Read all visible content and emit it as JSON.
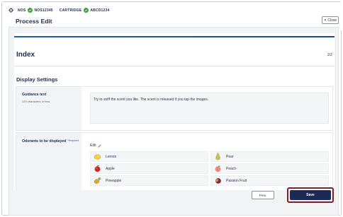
{
  "status": {
    "nos_label": "NOS",
    "nos_value": "NOS12345",
    "cartridge_label": "CARTRIDGE",
    "cartridge_value": "ABCD1234"
  },
  "header": {
    "title": "Process Edit",
    "close_label": "✕ Close"
  },
  "main": {
    "heading": "Index",
    "page_indicator": "2/2",
    "section_title": "Display Settings",
    "progress": 1.0
  },
  "guidance": {
    "label": "Guidance text",
    "sublabel": "120 characters or less",
    "value": "Try to sniff the scent you like. The scent is released if you tap the images."
  },
  "odorants": {
    "label": "Odorants to be displayed",
    "required": "*Required",
    "edit_label": "Edit",
    "items": [
      {
        "name": "Lemon",
        "icon": "lemon-icon"
      },
      {
        "name": "Pear",
        "icon": "pear-icon"
      },
      {
        "name": "Apple",
        "icon": "apple-icon"
      },
      {
        "name": "Peach",
        "icon": "peach-icon"
      },
      {
        "name": "Pineapple",
        "icon": "pineapple-icon"
      },
      {
        "name": "Passion Fruit",
        "icon": "passion-fruit-icon"
      }
    ]
  },
  "footer": {
    "prev_label": "Prev.",
    "save_label": "Save"
  },
  "colors": {
    "primary": "#1c2a55",
    "accent_border": "#7a1f2b",
    "status_green": "#3a9d3a",
    "progress_blue": "#1d5fa8"
  }
}
